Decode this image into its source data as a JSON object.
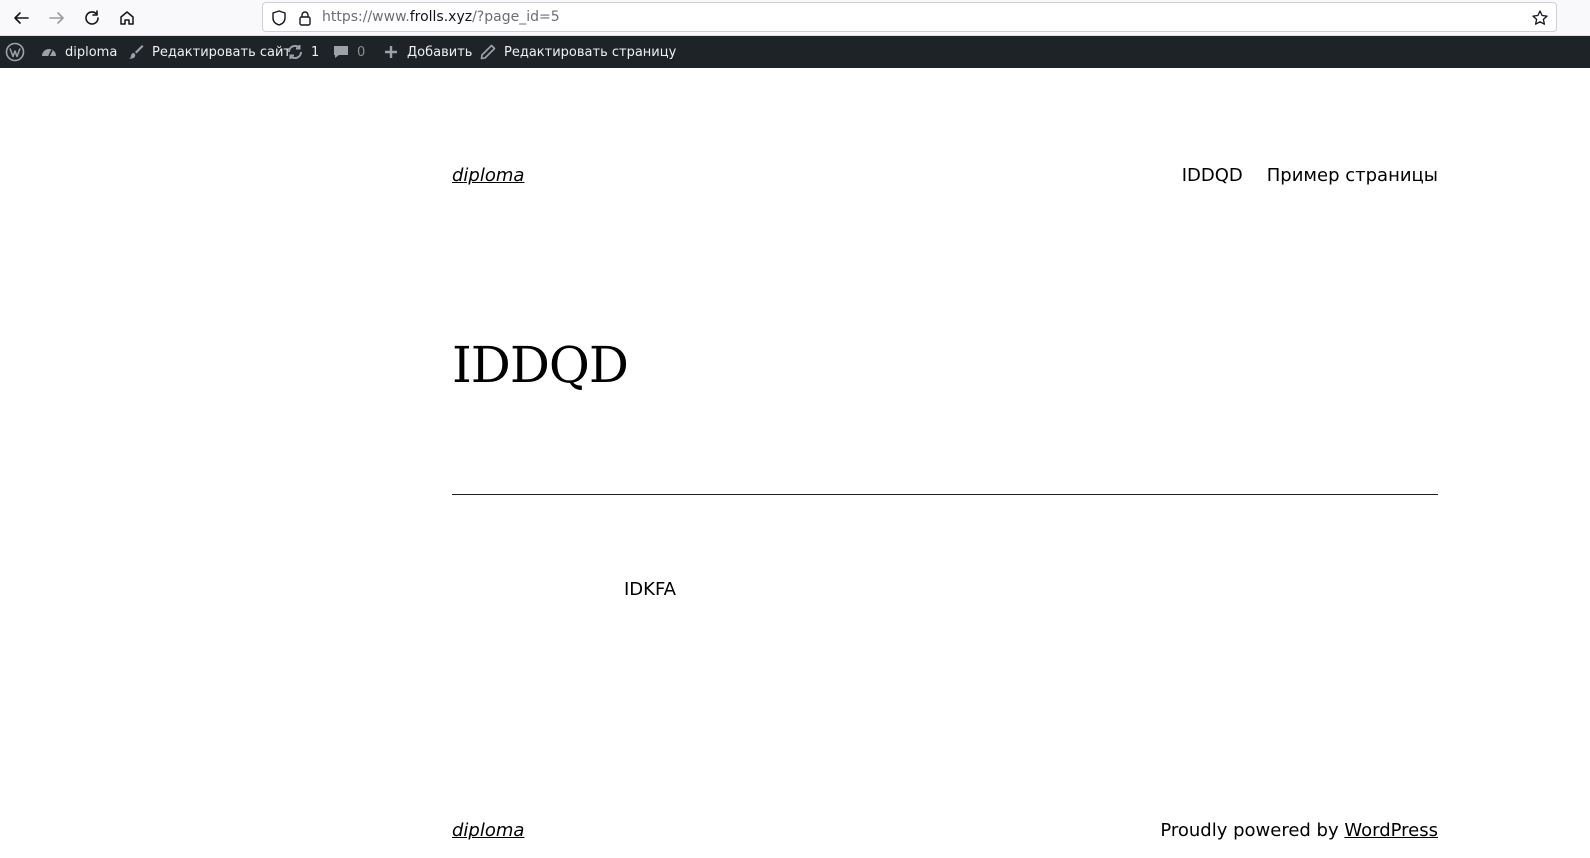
{
  "browser": {
    "url_prefix": "https://www.",
    "url_host": "frolls.xyz",
    "url_path": "/?page_id=5",
    "icons": [
      "back-icon",
      "forward-icon",
      "reload-icon",
      "home-icon",
      "shield-icon",
      "lock-icon",
      "star-icon"
    ]
  },
  "adminbar": {
    "site_name": "diploma",
    "customize": "Редактировать сайт",
    "updates_count": "1",
    "comments_count": "0",
    "new_content": "Добавить",
    "edit_page": "Редактировать страницу",
    "background_color": "#1d2327"
  },
  "header": {
    "site_title": "diploma",
    "nav": [
      "IDDQD",
      "Пример страницы"
    ]
  },
  "main": {
    "title": "IDDQD",
    "content": "IDKFA"
  },
  "footer": {
    "site_title": "diploma",
    "credit_prefix": "Proudly powered by ",
    "credit_link": "WordPress"
  }
}
